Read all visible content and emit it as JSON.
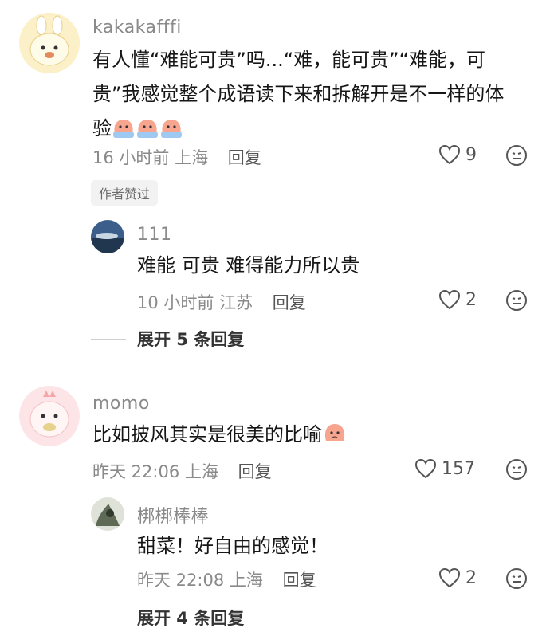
{
  "comments": [
    {
      "username": "kakakafffi",
      "text_line1": "有人懂“难能可贵”吗...“难，能可贵”“难能，可",
      "text_line2": "贵”我感觉整个成语读下来和拆解开是不一样的体",
      "text_line3": "验",
      "time": "16 小时前",
      "location": "上海",
      "reply_label": "回复",
      "likes": "9",
      "badge": "作者赞过",
      "replies": [
        {
          "username": "111",
          "text": "难能 可贵 难得能力所以贵",
          "time": "10 小时前",
          "location": "江苏",
          "reply_label": "回复",
          "likes": "2"
        }
      ],
      "expand_label": "展开 5 条回复"
    },
    {
      "username": "momo",
      "text": "比如披风其实是很美的比喻",
      "time": "昨天 22:06",
      "location": "上海",
      "reply_label": "回复",
      "likes": "157",
      "replies": [
        {
          "username": "梆梆棒棒",
          "text": "甜菜！好自由的感觉！",
          "time": "昨天 22:08",
          "location": "上海",
          "reply_label": "回复",
          "likes": "2"
        }
      ],
      "expand_label": "展开 4 条回复"
    }
  ],
  "icons": {
    "like": "heart-outline-icon",
    "dislike": "meh-face-icon",
    "emoji": "peach-crying-emoji"
  },
  "colors": {
    "meta": "#8a8a8a",
    "text": "#161616",
    "badge_bg": "#f2f2f2"
  }
}
